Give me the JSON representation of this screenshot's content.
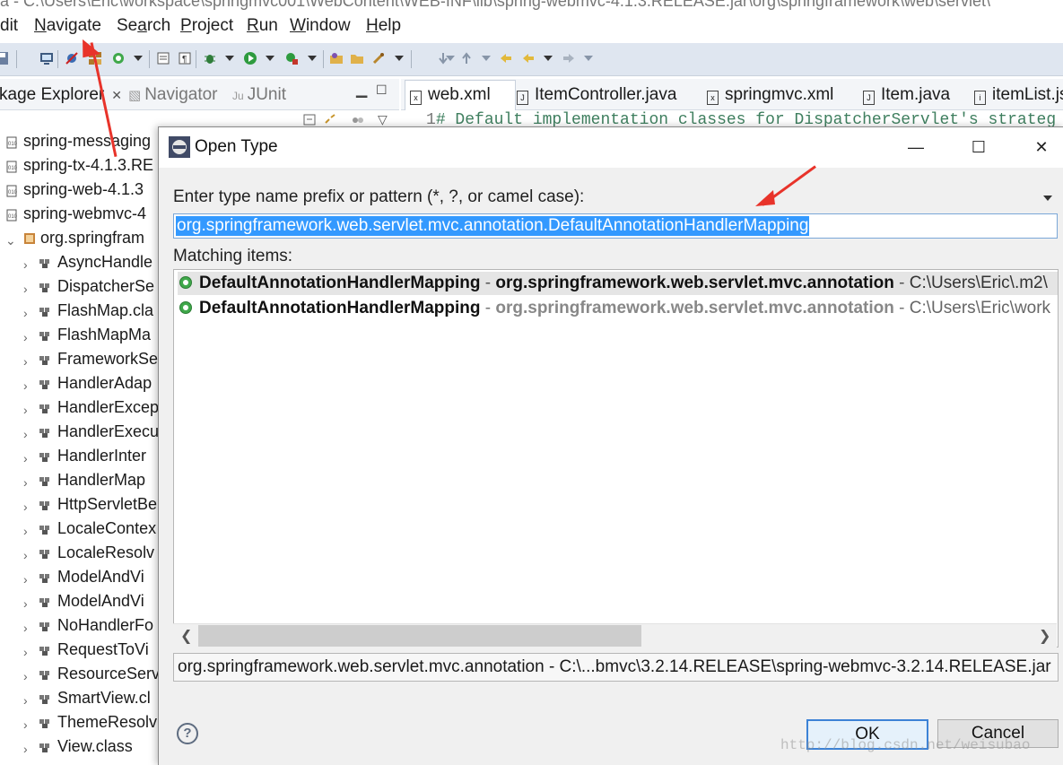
{
  "window": {
    "title": "a - C:\\Users\\Eric\\workspace\\springmvc001\\WebContent\\WEB-INF\\lib\\spring-webmvc-4.1.3.RELEASE.jar\\org\\springframework\\web\\servlet\\"
  },
  "menu": [
    {
      "label": "dit",
      "underline": ""
    },
    {
      "label": "Navigate",
      "underline": "N"
    },
    {
      "label": "Search",
      "underline": "a"
    },
    {
      "label": "Project",
      "underline": "P"
    },
    {
      "label": "Run",
      "underline": "R"
    },
    {
      "label": "Window",
      "underline": "W"
    },
    {
      "label": "Help",
      "underline": "H"
    }
  ],
  "left_view": {
    "tabs": [
      "kage Explorer",
      "Navigator",
      "JUnit"
    ],
    "jars": [
      "spring-messaging",
      "spring-tx-4.1.3.RE",
      "spring-web-4.1.3",
      "spring-webmvc-4"
    ],
    "package": "org.springfram",
    "classes": [
      "AsyncHandle",
      "DispatcherSe",
      "FlashMap.cla",
      "FlashMapMa",
      "FrameworkSe",
      "HandlerAdap",
      "HandlerExcep",
      "HandlerExecu",
      "HandlerInter",
      "HandlerMap",
      "HttpServletBe",
      "LocaleContex",
      "LocaleResolv",
      "ModelAndVi",
      "ModelAndVi",
      "NoHandlerFo",
      "RequestToVi",
      "ResourceServ",
      "SmartView.cl",
      "ThemeResolv",
      "View.class"
    ]
  },
  "editor": {
    "tabs": [
      "web.xml",
      "ItemController.java",
      "springmvc.xml",
      "Item.java",
      "itemList.js"
    ],
    "line_number": "1",
    "line_text": "# Default implementation classes for DispatcherServlet's strateg"
  },
  "dialog": {
    "title": "Open Type",
    "prompt": "Enter type name prefix or pattern (*, ?, or camel case):",
    "search_value": "org.springframework.web.servlet.mvc.annotation.DefaultAnnotationHandlerMapping",
    "matching_label": "Matching items:",
    "results": [
      {
        "name": "DefaultAnnotationHandlerMapping",
        "sep1": " - ",
        "package": "org.springframework.web.servlet.mvc.annotation",
        "sep2": " - ",
        "path": "C:\\Users\\Eric\\.m2\\"
      },
      {
        "name": "DefaultAnnotationHandlerMapping",
        "sep1": " - ",
        "package": "org.springframework.web.servlet.mvc.annotation",
        "sep2": " - ",
        "path": "C:\\Users\\Eric\\work"
      }
    ],
    "status": "org.springframework.web.servlet.mvc.annotation - C:\\...bmvc\\3.2.14.RELEASE\\spring-webmvc-3.2.14.RELEASE.jar",
    "help": "?",
    "ok": "OK",
    "cancel": "Cancel",
    "minimize": "—",
    "maximize": "☐",
    "close": "✕"
  },
  "watermark": "http://blog.csdn.net/weisubao",
  "colors": {
    "accent": "#3399ff",
    "annotation_arrow": "#e8332a",
    "class_icon": "#3fa84a"
  }
}
